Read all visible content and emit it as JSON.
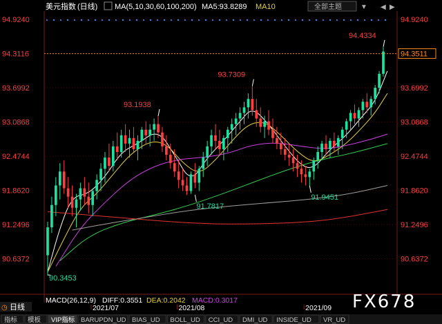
{
  "header": {
    "title": "美元指数",
    "period": "(日线)",
    "ma_settings": "MA(5,10,30,60,100,200)",
    "ma5_label": "MA5:93.8289",
    "ma10_label": "MA10",
    "theme_button": "全部主题"
  },
  "price_axis": {
    "ticks": [
      "94.9240",
      "94.3116",
      "93.6992",
      "93.0868",
      "92.4744",
      "91.8620",
      "91.2496",
      "90.6372"
    ],
    "tick_values": [
      94.924,
      94.3116,
      93.6992,
      93.0868,
      92.4744,
      91.862,
      91.2496,
      90.6372
    ],
    "range": [
      90.05,
      95.05
    ],
    "current_price_box": "94.3511"
  },
  "annotations": [
    {
      "text": "94.4334",
      "price": 94.4334,
      "index": 82
    },
    {
      "text": "93.7309",
      "price": 93.7309,
      "index": 50
    },
    {
      "text": "93.1938",
      "price": 93.1938,
      "index": 27
    },
    {
      "text": "91.9451",
      "price": 91.9451,
      "index": 64
    },
    {
      "text": "91.7817",
      "price": 91.7817,
      "index": 36
    },
    {
      "text": "90.3453",
      "price": 90.3453,
      "index": 0
    }
  ],
  "macd_bar": {
    "title": "MACD(26,12,9)",
    "diff": "DIFF:0.3551",
    "dea": "DEA:0.2042",
    "macd": "MACD:0.3017"
  },
  "dates": [
    {
      "label": "2021/07",
      "index": 14
    },
    {
      "label": "2021/08",
      "index": 35
    },
    {
      "label": "2021/09",
      "index": 66
    }
  ],
  "bottom_tabs": {
    "left_label": "日线",
    "items": [
      "指标",
      "模板",
      "VIP指标",
      "BARUPDN_UD",
      "BIAS_UD",
      "BOLL_UD",
      "CCI_UD",
      "DMI_UD",
      "INSIDE_UD",
      "VR_UD"
    ]
  },
  "watermark": "FX678",
  "colors": {
    "up": "#1ee0a0",
    "down": "#ff3e3e",
    "accent": "#ff8c1a",
    "axis_text": "#ff3e3e",
    "ma5": "#ffffff",
    "ma10": "#e8d03a",
    "ma30": "#d040e8",
    "ma60": "#30d050",
    "ma100": "#a0a0a0",
    "ma200": "#e83030"
  },
  "chart_data": {
    "type": "candlestick",
    "ylim": [
      90.05,
      95.05
    ],
    "candles": [
      [
        90.7,
        91.3,
        90.34,
        91.2
      ],
      [
        91.2,
        91.75,
        91.1,
        91.6
      ],
      [
        91.6,
        92.1,
        91.4,
        91.95
      ],
      [
        91.95,
        92.35,
        91.7,
        92.2
      ],
      [
        92.2,
        92.4,
        91.8,
        91.9
      ],
      [
        91.9,
        92.1,
        91.55,
        91.75
      ],
      [
        91.75,
        91.95,
        91.4,
        91.55
      ],
      [
        91.55,
        91.8,
        91.2,
        91.7
      ],
      [
        91.7,
        92.0,
        91.5,
        91.9
      ],
      [
        91.9,
        92.1,
        91.6,
        91.75
      ],
      [
        91.75,
        92.0,
        91.45,
        91.6
      ],
      [
        91.6,
        91.9,
        91.4,
        91.85
      ],
      [
        91.85,
        92.15,
        91.7,
        92.05
      ],
      [
        92.05,
        92.35,
        91.85,
        92.25
      ],
      [
        92.25,
        92.55,
        92.0,
        92.45
      ],
      [
        92.45,
        92.7,
        92.2,
        92.3
      ],
      [
        92.3,
        92.75,
        92.2,
        92.65
      ],
      [
        92.65,
        92.9,
        92.4,
        92.55
      ],
      [
        92.55,
        92.95,
        92.45,
        92.85
      ],
      [
        92.85,
        93.05,
        92.55,
        92.7
      ],
      [
        92.7,
        92.95,
        92.45,
        92.8
      ],
      [
        92.8,
        93.0,
        92.55,
        92.6
      ],
      [
        92.6,
        92.85,
        92.4,
        92.75
      ],
      [
        92.75,
        93.0,
        92.6,
        92.95
      ],
      [
        92.95,
        93.1,
        92.7,
        92.85
      ],
      [
        92.85,
        93.05,
        92.65,
        92.95
      ],
      [
        92.95,
        93.15,
        92.75,
        93.05
      ],
      [
        93.05,
        93.19,
        92.8,
        92.9
      ],
      [
        92.9,
        93.0,
        92.55,
        92.65
      ],
      [
        92.65,
        92.85,
        92.4,
        92.5
      ],
      [
        92.5,
        92.7,
        92.25,
        92.35
      ],
      [
        92.35,
        92.6,
        92.1,
        92.2
      ],
      [
        92.2,
        92.4,
        91.9,
        92.05
      ],
      [
        92.05,
        92.25,
        91.85,
        91.95
      ],
      [
        91.95,
        92.1,
        91.78,
        91.85
      ],
      [
        91.85,
        92.2,
        91.8,
        92.15
      ],
      [
        92.15,
        92.35,
        91.9,
        92.0
      ],
      [
        92.0,
        92.3,
        91.85,
        92.25
      ],
      [
        92.25,
        92.55,
        92.1,
        92.45
      ],
      [
        92.45,
        92.75,
        92.3,
        92.65
      ],
      [
        92.65,
        92.95,
        92.5,
        92.85
      ],
      [
        92.85,
        93.05,
        92.6,
        92.75
      ],
      [
        92.75,
        92.95,
        92.5,
        92.6
      ],
      [
        92.6,
        92.85,
        92.4,
        92.8
      ],
      [
        92.8,
        93.0,
        92.55,
        92.95
      ],
      [
        92.95,
        93.15,
        92.7,
        93.05
      ],
      [
        93.05,
        93.25,
        92.85,
        93.15
      ],
      [
        93.15,
        93.35,
        92.95,
        93.25
      ],
      [
        93.25,
        93.45,
        93.05,
        93.35
      ],
      [
        93.35,
        93.6,
        93.15,
        93.5
      ],
      [
        93.5,
        93.73,
        93.2,
        93.3
      ],
      [
        93.3,
        93.5,
        93.0,
        93.15
      ],
      [
        93.15,
        93.35,
        92.9,
        93.0
      ],
      [
        93.0,
        93.2,
        92.8,
        93.1
      ],
      [
        93.1,
        93.3,
        92.85,
        92.95
      ],
      [
        92.95,
        93.15,
        92.7,
        92.8
      ],
      [
        92.8,
        93.0,
        92.6,
        92.7
      ],
      [
        92.7,
        92.9,
        92.5,
        92.6
      ],
      [
        92.6,
        92.8,
        92.4,
        92.5
      ],
      [
        92.5,
        92.7,
        92.3,
        92.45
      ],
      [
        92.45,
        92.6,
        92.2,
        92.35
      ],
      [
        92.35,
        92.5,
        92.1,
        92.25
      ],
      [
        92.25,
        92.4,
        92.0,
        92.15
      ],
      [
        92.15,
        92.3,
        91.95,
        92.1
      ],
      [
        92.1,
        92.25,
        91.94,
        92.2
      ],
      [
        92.2,
        92.45,
        92.05,
        92.4
      ],
      [
        92.4,
        92.65,
        92.25,
        92.55
      ],
      [
        92.55,
        92.75,
        92.4,
        92.7
      ],
      [
        92.7,
        92.85,
        92.5,
        92.6
      ],
      [
        92.6,
        92.8,
        92.45,
        92.75
      ],
      [
        92.75,
        92.9,
        92.55,
        92.65
      ],
      [
        92.65,
        92.85,
        92.5,
        92.8
      ],
      [
        92.8,
        93.0,
        92.6,
        92.95
      ],
      [
        92.95,
        93.15,
        92.8,
        93.1
      ],
      [
        93.1,
        93.3,
        92.95,
        93.25
      ],
      [
        93.25,
        93.4,
        93.05,
        93.15
      ],
      [
        93.15,
        93.35,
        93.0,
        93.3
      ],
      [
        93.3,
        93.5,
        93.15,
        93.45
      ],
      [
        93.45,
        93.6,
        93.25,
        93.35
      ],
      [
        93.35,
        93.55,
        93.2,
        93.5
      ],
      [
        93.5,
        93.75,
        93.4,
        93.7
      ],
      [
        93.7,
        94.0,
        93.6,
        93.95
      ],
      [
        93.95,
        94.43,
        93.9,
        94.35
      ]
    ],
    "ma_lines": [
      {
        "name": "MA5",
        "color": "#ffffff",
        "points": [
          [
            0,
            90.4
          ],
          [
            3,
            91.2
          ],
          [
            6,
            91.75
          ],
          [
            10,
            91.8
          ],
          [
            14,
            92.1
          ],
          [
            18,
            92.55
          ],
          [
            22,
            92.7
          ],
          [
            27,
            92.95
          ],
          [
            31,
            92.5
          ],
          [
            35,
            92.0
          ],
          [
            39,
            92.45
          ],
          [
            43,
            92.75
          ],
          [
            47,
            93.1
          ],
          [
            50,
            93.35
          ],
          [
            54,
            93.05
          ],
          [
            58,
            92.65
          ],
          [
            62,
            92.3
          ],
          [
            65,
            92.25
          ],
          [
            69,
            92.6
          ],
          [
            73,
            92.85
          ],
          [
            77,
            93.2
          ],
          [
            80,
            93.45
          ],
          [
            83,
            94.0
          ]
        ]
      },
      {
        "name": "MA10",
        "color": "#e8d03a",
        "points": [
          [
            0,
            90.4
          ],
          [
            4,
            91.0
          ],
          [
            8,
            91.55
          ],
          [
            12,
            91.8
          ],
          [
            16,
            92.15
          ],
          [
            20,
            92.5
          ],
          [
            25,
            92.75
          ],
          [
            29,
            92.7
          ],
          [
            33,
            92.35
          ],
          [
            37,
            92.15
          ],
          [
            41,
            92.4
          ],
          [
            45,
            92.75
          ],
          [
            49,
            93.05
          ],
          [
            53,
            93.1
          ],
          [
            57,
            92.85
          ],
          [
            61,
            92.55
          ],
          [
            65,
            92.35
          ],
          [
            69,
            92.5
          ],
          [
            73,
            92.7
          ],
          [
            77,
            93.0
          ],
          [
            80,
            93.25
          ],
          [
            83,
            93.6
          ]
        ]
      },
      {
        "name": "MA30",
        "color": "#d040e8",
        "points": [
          [
            2,
            90.5
          ],
          [
            8,
            91.2
          ],
          [
            14,
            91.65
          ],
          [
            20,
            92.05
          ],
          [
            26,
            92.3
          ],
          [
            32,
            92.42
          ],
          [
            38,
            92.45
          ],
          [
            44,
            92.52
          ],
          [
            50,
            92.68
          ],
          [
            56,
            92.72
          ],
          [
            62,
            92.65
          ],
          [
            68,
            92.6
          ],
          [
            74,
            92.68
          ],
          [
            80,
            92.8
          ],
          [
            83,
            92.87
          ]
        ]
      },
      {
        "name": "MA60",
        "color": "#30d050",
        "points": [
          [
            3,
            90.6
          ],
          [
            10,
            91.05
          ],
          [
            18,
            91.28
          ],
          [
            26,
            91.42
          ],
          [
            34,
            91.58
          ],
          [
            42,
            91.78
          ],
          [
            50,
            92.0
          ],
          [
            58,
            92.22
          ],
          [
            66,
            92.4
          ],
          [
            74,
            92.52
          ],
          [
            83,
            92.7
          ]
        ]
      },
      {
        "name": "MA100",
        "color": "#a0a0a0",
        "points": [
          [
            6,
            91.15
          ],
          [
            14,
            91.26
          ],
          [
            24,
            91.38
          ],
          [
            34,
            91.5
          ],
          [
            44,
            91.58
          ],
          [
            54,
            91.64
          ],
          [
            64,
            91.7
          ],
          [
            74,
            91.8
          ],
          [
            83,
            91.95
          ]
        ]
      },
      {
        "name": "MA200",
        "color": "#e83030",
        "points": [
          [
            0,
            91.48
          ],
          [
            10,
            91.42
          ],
          [
            20,
            91.36
          ],
          [
            30,
            91.3
          ],
          [
            40,
            91.26
          ],
          [
            50,
            91.26
          ],
          [
            60,
            91.28
          ],
          [
            70,
            91.34
          ],
          [
            83,
            91.52
          ]
        ]
      }
    ]
  }
}
